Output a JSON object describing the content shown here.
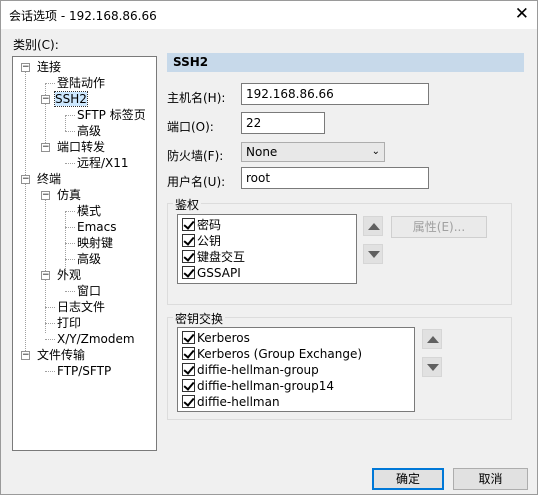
{
  "window": {
    "title": "会话选项 - 192.168.86.66",
    "close_glyph": "✕"
  },
  "category": {
    "label": "类别(C):",
    "items": [
      {
        "label": "连接",
        "expander": "−"
      },
      {
        "label": "登陆动作"
      },
      {
        "label": "SSH2",
        "expander": "−",
        "selected": true
      },
      {
        "label": "SFTP 标签页"
      },
      {
        "label": "高级"
      },
      {
        "label": "端口转发",
        "expander": "−"
      },
      {
        "label": "远程/X11"
      },
      {
        "label": "终端",
        "expander": "−"
      },
      {
        "label": "仿真",
        "expander": "−"
      },
      {
        "label": "模式"
      },
      {
        "label": "Emacs"
      },
      {
        "label": "映射键"
      },
      {
        "label": "高级"
      },
      {
        "label": "外观",
        "expander": "−"
      },
      {
        "label": "窗口"
      },
      {
        "label": "日志文件"
      },
      {
        "label": "打印"
      },
      {
        "label": "X/Y/Zmodem"
      },
      {
        "label": "文件传输",
        "expander": "−"
      },
      {
        "label": "FTP/SFTP"
      }
    ]
  },
  "section": {
    "title": "SSH2"
  },
  "form": {
    "hostname": {
      "label": "主机名(H):",
      "value": "192.168.86.66"
    },
    "port": {
      "label": "端口(O):",
      "value": "22"
    },
    "firewall": {
      "label": "防火墙(F):",
      "value": "None"
    },
    "username": {
      "label": "用户名(U):",
      "value": "root"
    }
  },
  "auth": {
    "title": "鉴权",
    "items": [
      "密码",
      "公钥",
      "键盘交互",
      "GSSAPI"
    ],
    "properties_button": "属性(E)..."
  },
  "kex": {
    "title": "密钥交换",
    "items": [
      "Kerberos",
      "Kerberos (Group Exchange)",
      "diffie-hellman-group",
      "diffie-hellman-group14",
      "diffie-hellman"
    ]
  },
  "buttons": {
    "ok": "确定",
    "cancel": "取消"
  },
  "colors": {
    "section_header": "#c7d9ea",
    "default_button_border": "#0078d7",
    "selection": "#cde8ff"
  }
}
